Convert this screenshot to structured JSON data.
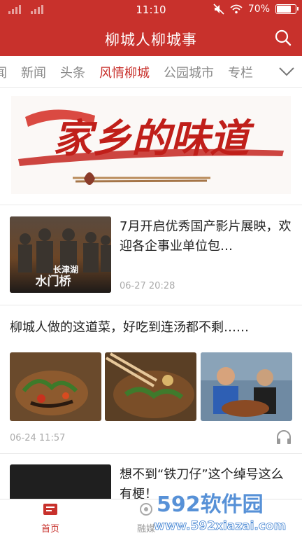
{
  "status_bar": {
    "time": "11:10",
    "battery_text": "70%",
    "battery_level": 0.7
  },
  "header": {
    "title": "柳城人柳城事"
  },
  "tabs": [
    {
      "label": "闻"
    },
    {
      "label": "新闻"
    },
    {
      "label": "头条"
    },
    {
      "label": "风情柳城",
      "active": true
    },
    {
      "label": "公园城市"
    },
    {
      "label": "专栏"
    }
  ],
  "banner": {
    "text": "家乡的味道"
  },
  "articles": [
    {
      "title": "7月开启优秀国产影片展映，欢迎各企事业单位包…",
      "time": "06-27 20:28",
      "thumb_text_top": "长津湖",
      "thumb_text_bottom": "水门桥"
    },
    {
      "title": "柳城人做的这道菜，好吃到连汤都不剩……",
      "time": "06-24 11:57"
    },
    {
      "title": "想不到“铁刀仔”这个绰号这么有梗！"
    }
  ],
  "bottom_nav": {
    "home_label": "首页",
    "media_label": "融媒"
  },
  "watermark": {
    "brand": "592软件园",
    "url": "www.592xiazai.com"
  },
  "colors": {
    "brand_red": "#c8312c",
    "muted": "#888888"
  },
  "icons": [
    "search-icon",
    "chevron-down-icon",
    "headphones-icon",
    "home-icon",
    "media-icon",
    "mute-icon",
    "wifi-icon",
    "battery-icon"
  ]
}
